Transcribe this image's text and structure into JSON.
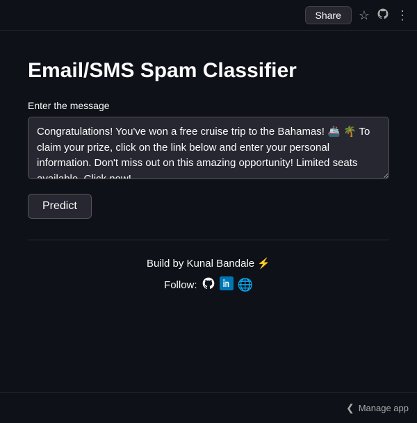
{
  "topbar": {
    "share_label": "Share",
    "star_icon": "☆",
    "github_icon": "⊙",
    "menu_icon": "⋮"
  },
  "app": {
    "title": "Email/SMS Spam Classifier",
    "input_label": "Enter the message",
    "message_value": "Congratulations! You've won a free cruise trip to the Bahamas! 🚢 🌴 To claim your prize, click on the link below and enter your personal information. Don't miss out on this amazing opportunity! Limited seats available. Click now!",
    "predict_button": "Predict"
  },
  "footer": {
    "build_text": "Build by Kunal Bandale ⚡",
    "follow_label": "Follow:",
    "github_icon": "github",
    "linkedin_icon": "linkedin",
    "web_icon": "web"
  },
  "bottombar": {
    "manage_app_label": "Manage app",
    "chevron": "❮"
  }
}
